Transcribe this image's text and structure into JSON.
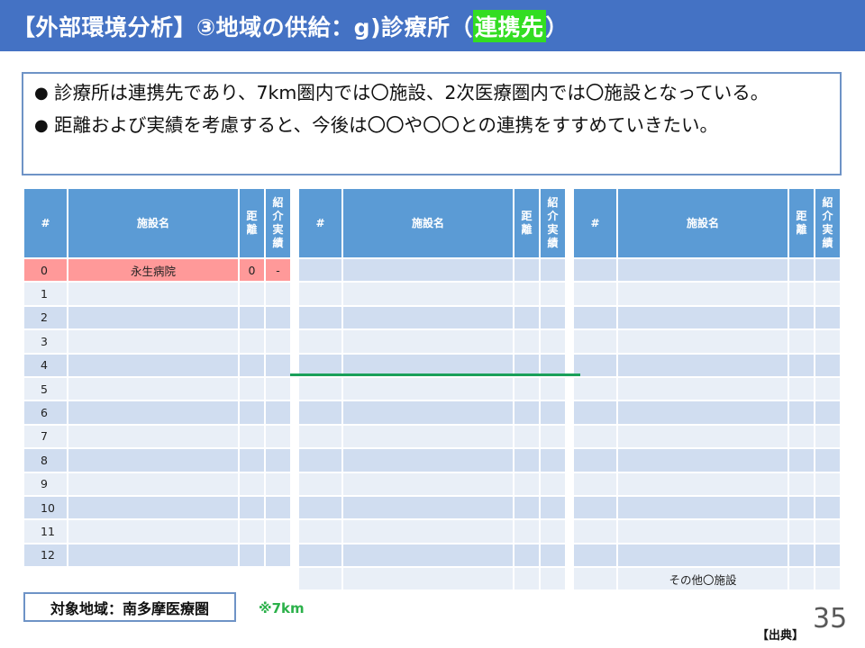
{
  "title": {
    "prefix": "【外部環境分析】③地域の供給：g)診療所（",
    "highlight": "連携先",
    "suffix": "）"
  },
  "summary": {
    "bullets": [
      "診療所は連携先であり、7km圏内では〇施設、2次医療圏内では〇施設となっている。",
      "距離および実績を考慮すると、今後は〇〇や〇〇との連携をすすめていきたい。"
    ]
  },
  "tables": {
    "headers": {
      "num": "#",
      "name": "施設名",
      "distance": "距離",
      "referral": "紹介実績"
    },
    "table1": {
      "rows": [
        {
          "num": "0",
          "name": "永生病院",
          "distance": "0",
          "referral": "-"
        },
        {
          "num": "1",
          "name": "",
          "distance": "",
          "referral": ""
        },
        {
          "num": "2",
          "name": "",
          "distance": "",
          "referral": ""
        },
        {
          "num": "3",
          "name": "",
          "distance": "",
          "referral": ""
        },
        {
          "num": "4",
          "name": "",
          "distance": "",
          "referral": ""
        },
        {
          "num": "5",
          "name": "",
          "distance": "",
          "referral": ""
        },
        {
          "num": "6",
          "name": "",
          "distance": "",
          "referral": ""
        },
        {
          "num": "7",
          "name": "",
          "distance": "",
          "referral": ""
        },
        {
          "num": "8",
          "name": "",
          "distance": "",
          "referral": ""
        },
        {
          "num": "9",
          "name": "",
          "distance": "",
          "referral": ""
        },
        {
          "num": "10",
          "name": "",
          "distance": "",
          "referral": ""
        },
        {
          "num": "11",
          "name": "",
          "distance": "",
          "referral": ""
        },
        {
          "num": "12",
          "name": "",
          "distance": "",
          "referral": ""
        }
      ]
    },
    "table2": {
      "rows": [
        {
          "num": "",
          "name": "",
          "distance": "",
          "referral": ""
        },
        {
          "num": "",
          "name": "",
          "distance": "",
          "referral": ""
        },
        {
          "num": "",
          "name": "",
          "distance": "",
          "referral": ""
        },
        {
          "num": "",
          "name": "",
          "distance": "",
          "referral": ""
        },
        {
          "num": "",
          "name": "",
          "distance": "",
          "referral": ""
        },
        {
          "num": "",
          "name": "",
          "distance": "",
          "referral": ""
        },
        {
          "num": "",
          "name": "",
          "distance": "",
          "referral": ""
        },
        {
          "num": "",
          "name": "",
          "distance": "",
          "referral": ""
        },
        {
          "num": "",
          "name": "",
          "distance": "",
          "referral": ""
        },
        {
          "num": "",
          "name": "",
          "distance": "",
          "referral": ""
        },
        {
          "num": "",
          "name": "",
          "distance": "",
          "referral": ""
        },
        {
          "num": "",
          "name": "",
          "distance": "",
          "referral": ""
        },
        {
          "num": "",
          "name": "",
          "distance": "",
          "referral": ""
        },
        {
          "num": "",
          "name": "",
          "distance": "",
          "referral": ""
        }
      ]
    },
    "table3": {
      "rows": [
        {
          "num": "",
          "name": "",
          "distance": "",
          "referral": ""
        },
        {
          "num": "",
          "name": "",
          "distance": "",
          "referral": ""
        },
        {
          "num": "",
          "name": "",
          "distance": "",
          "referral": ""
        },
        {
          "num": "",
          "name": "",
          "distance": "",
          "referral": ""
        },
        {
          "num": "",
          "name": "",
          "distance": "",
          "referral": ""
        },
        {
          "num": "",
          "name": "",
          "distance": "",
          "referral": ""
        },
        {
          "num": "",
          "name": "",
          "distance": "",
          "referral": ""
        },
        {
          "num": "",
          "name": "",
          "distance": "",
          "referral": ""
        },
        {
          "num": "",
          "name": "",
          "distance": "",
          "referral": ""
        },
        {
          "num": "",
          "name": "",
          "distance": "",
          "referral": ""
        },
        {
          "num": "",
          "name": "",
          "distance": "",
          "referral": ""
        },
        {
          "num": "",
          "name": "",
          "distance": "",
          "referral": ""
        },
        {
          "num": "",
          "name": "",
          "distance": "",
          "referral": ""
        },
        {
          "num": "",
          "name": "その他〇施設",
          "distance": "",
          "referral": ""
        }
      ]
    }
  },
  "footer": {
    "region": "対象地域：南多摩医療圏",
    "km_note": "※7km",
    "source": "【出典】",
    "page_number": "35"
  },
  "colors": {
    "title_bg": "#4472c4",
    "title_highlight": "#33dd22",
    "header_bg": "#5b9bd5",
    "row_dark": "#d0ddf0",
    "row_light": "#e9eff7",
    "highlight_row": "#ff9999",
    "divider_line": "#1aa05a",
    "km_note": "#2bb14a"
  }
}
